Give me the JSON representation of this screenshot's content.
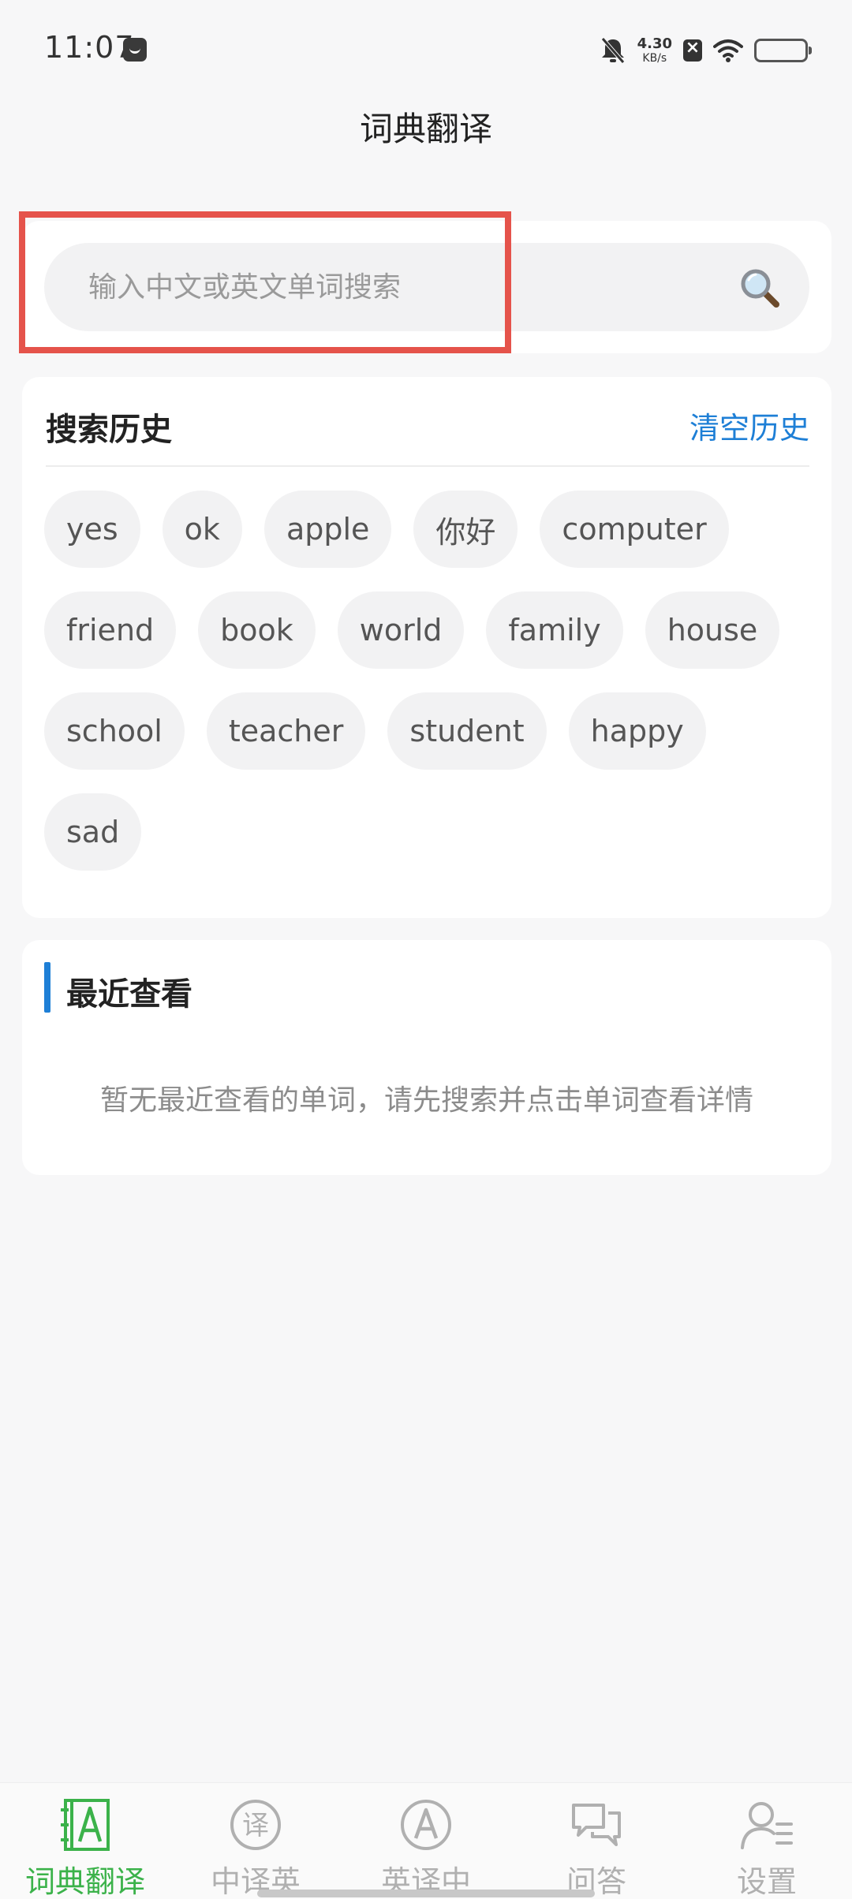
{
  "status_bar": {
    "time": "11:07",
    "net_speed_value": "4.30",
    "net_speed_unit": "KB/s",
    "icons": [
      "app-notification-icon",
      "mute-icon",
      "sim-icon",
      "wifi-icon",
      "battery-icon"
    ]
  },
  "header": {
    "title": "词典翻译"
  },
  "search": {
    "placeholder": "输入中文或英文单词搜索",
    "icon": "search-icon"
  },
  "history": {
    "title": "搜索历史",
    "clear_label": "清空历史",
    "items": [
      "yes",
      "ok",
      "apple",
      "你好",
      "computer",
      "friend",
      "book",
      "world",
      "family",
      "house",
      "school",
      "teacher",
      "student",
      "happy",
      "sad"
    ]
  },
  "recent": {
    "title": "最近查看",
    "empty_text": "暂无最近查看的单词，请先搜索并点击单词查看详情"
  },
  "nav": {
    "items": [
      {
        "label": "词典翻译",
        "icon": "dictionary-icon",
        "active": true
      },
      {
        "label": "中译英",
        "icon": "translate-zh-en-icon",
        "active": false
      },
      {
        "label": "英译中",
        "icon": "translate-en-zh-icon",
        "active": false
      },
      {
        "label": "问答",
        "icon": "chat-icon",
        "active": false
      },
      {
        "label": "设置",
        "icon": "user-settings-icon",
        "active": false
      }
    ]
  },
  "colors": {
    "accent_blue": "#1e7fd6",
    "active_green": "#3bb24a",
    "highlight_red": "#e5534b"
  }
}
